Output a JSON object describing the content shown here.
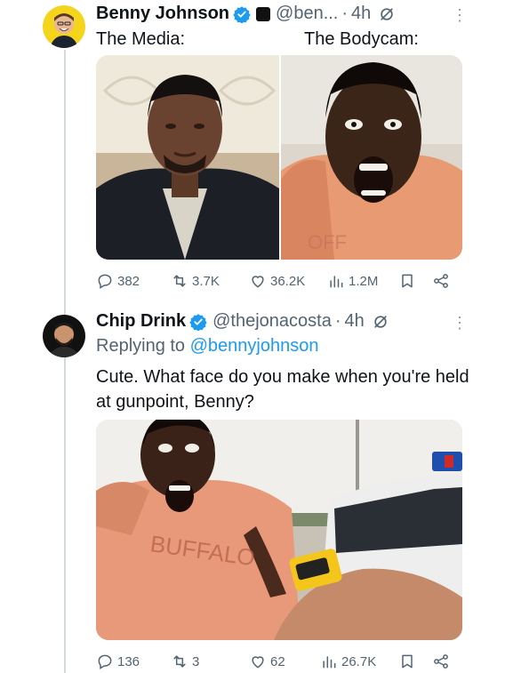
{
  "tweet1": {
    "display_name": "Benny Johnson",
    "handle": "@ben...",
    "time": "4h",
    "caption_left": "The Media:",
    "caption_right": "The Bodycam:",
    "stats": {
      "replies": "382",
      "reposts": "3.7K",
      "likes": "36.2K",
      "views": "1.2M"
    }
  },
  "tweet2": {
    "display_name": "Chip Drink",
    "handle": "@thejonacosta",
    "time": "4h",
    "replying_prefix": "Replying to",
    "replying_to": "@bennyjohnson",
    "text": "Cute. What face do you make when you're held at gunpoint, Benny?",
    "stats": {
      "replies": "136",
      "reposts": "3",
      "likes": "62",
      "views": "26.7K"
    }
  },
  "colors": {
    "verified": "#1d9bf0",
    "secondary_text": "#536471",
    "link": "#1d9bf0",
    "thread_line": "#cfd9de"
  }
}
